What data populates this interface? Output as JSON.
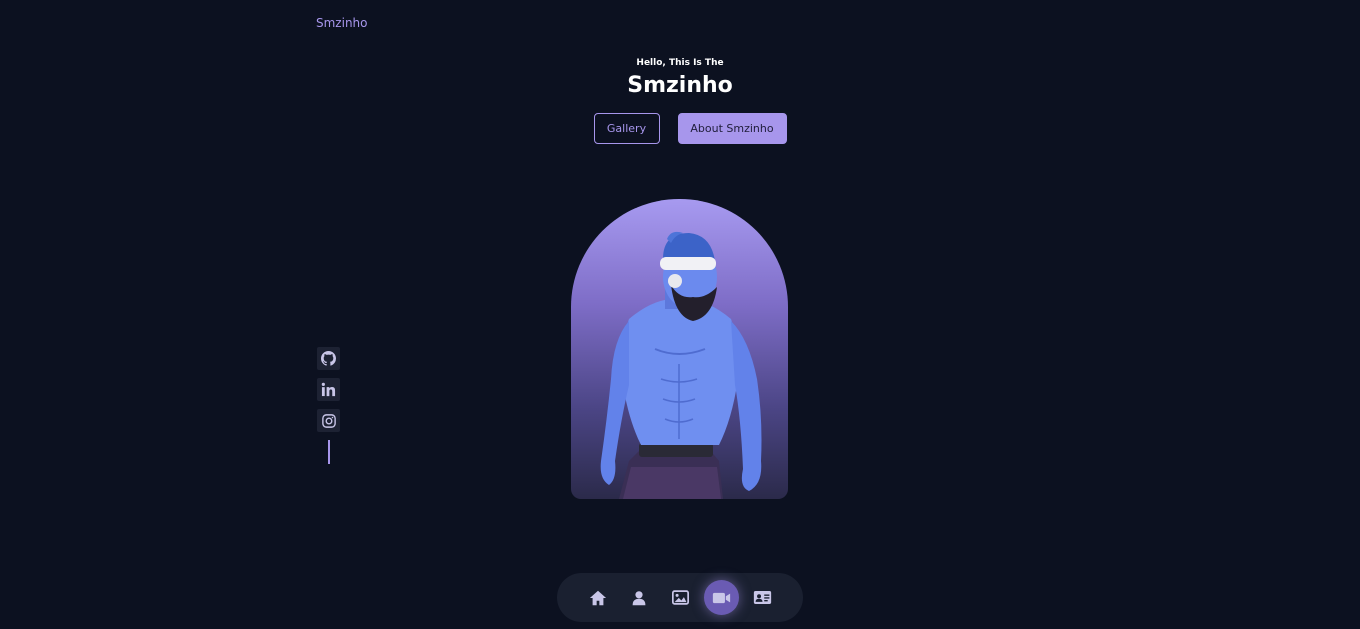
{
  "nav": {
    "logo": "Smzinho"
  },
  "hero": {
    "greeting": "Hello, This Is The",
    "name": "Smzinho",
    "gallery_button": "Gallery",
    "about_button": "About Smzinho"
  },
  "socials": [
    {
      "icon": "github-icon"
    },
    {
      "icon": "linkedin-icon"
    },
    {
      "icon": "instagram-icon"
    }
  ],
  "bottom_nav": [
    {
      "icon": "home-icon",
      "active": false
    },
    {
      "icon": "user-icon",
      "active": false
    },
    {
      "icon": "image-icon",
      "active": false
    },
    {
      "icon": "video-icon",
      "active": true
    },
    {
      "icon": "contact-card-icon",
      "active": false
    }
  ],
  "colors": {
    "background": "#0c1120",
    "accent": "#a796ec",
    "nav_background": "#1a2030"
  }
}
